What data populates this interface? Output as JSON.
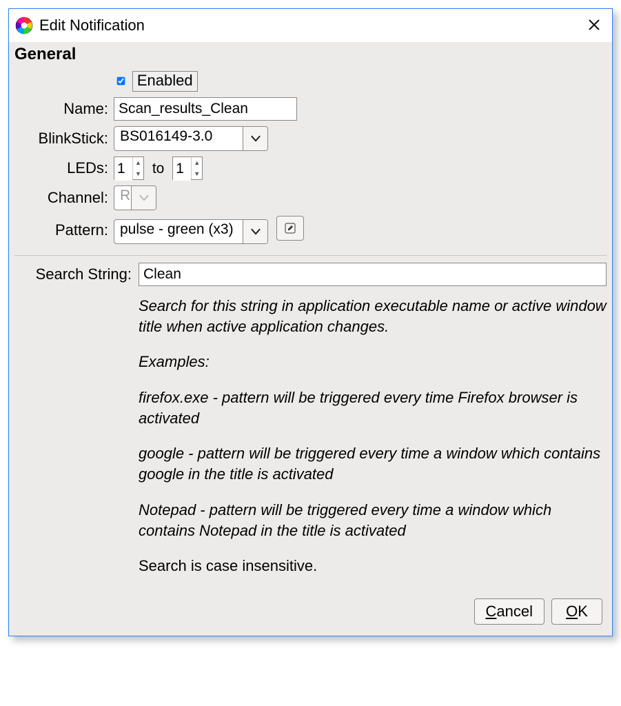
{
  "window": {
    "title": "Edit Notification"
  },
  "section_heading": "General",
  "labels": {
    "enabled": "Enabled",
    "name": "Name:",
    "blinkstick": "BlinkStick:",
    "leds": "LEDs:",
    "to": "to",
    "channel": "Channel:",
    "pattern": "Pattern:",
    "search_string": "Search String:"
  },
  "values": {
    "enabled_checked": true,
    "name": "Scan_results_Clean",
    "blinkstick": "BS016149-3.0",
    "led_from": "1",
    "led_to": "1",
    "channel": "R",
    "pattern": "pulse - green (x3)",
    "search_string": "Clean"
  },
  "help": {
    "p1": "Search for this string in application executable name or active window title when active application changes.",
    "p2": "Examples:",
    "p3": "firefox.exe - pattern will be triggered every time Firefox browser is activated",
    "p4": "google - pattern will be triggered every time a window which contains google in the title is activated",
    "p5": "Notepad - pattern will be triggered every time a window which contains Notepad in the title is activated",
    "p6": "Search is case insensitive."
  },
  "buttons": {
    "cancel": "Cancel",
    "ok": "OK"
  }
}
